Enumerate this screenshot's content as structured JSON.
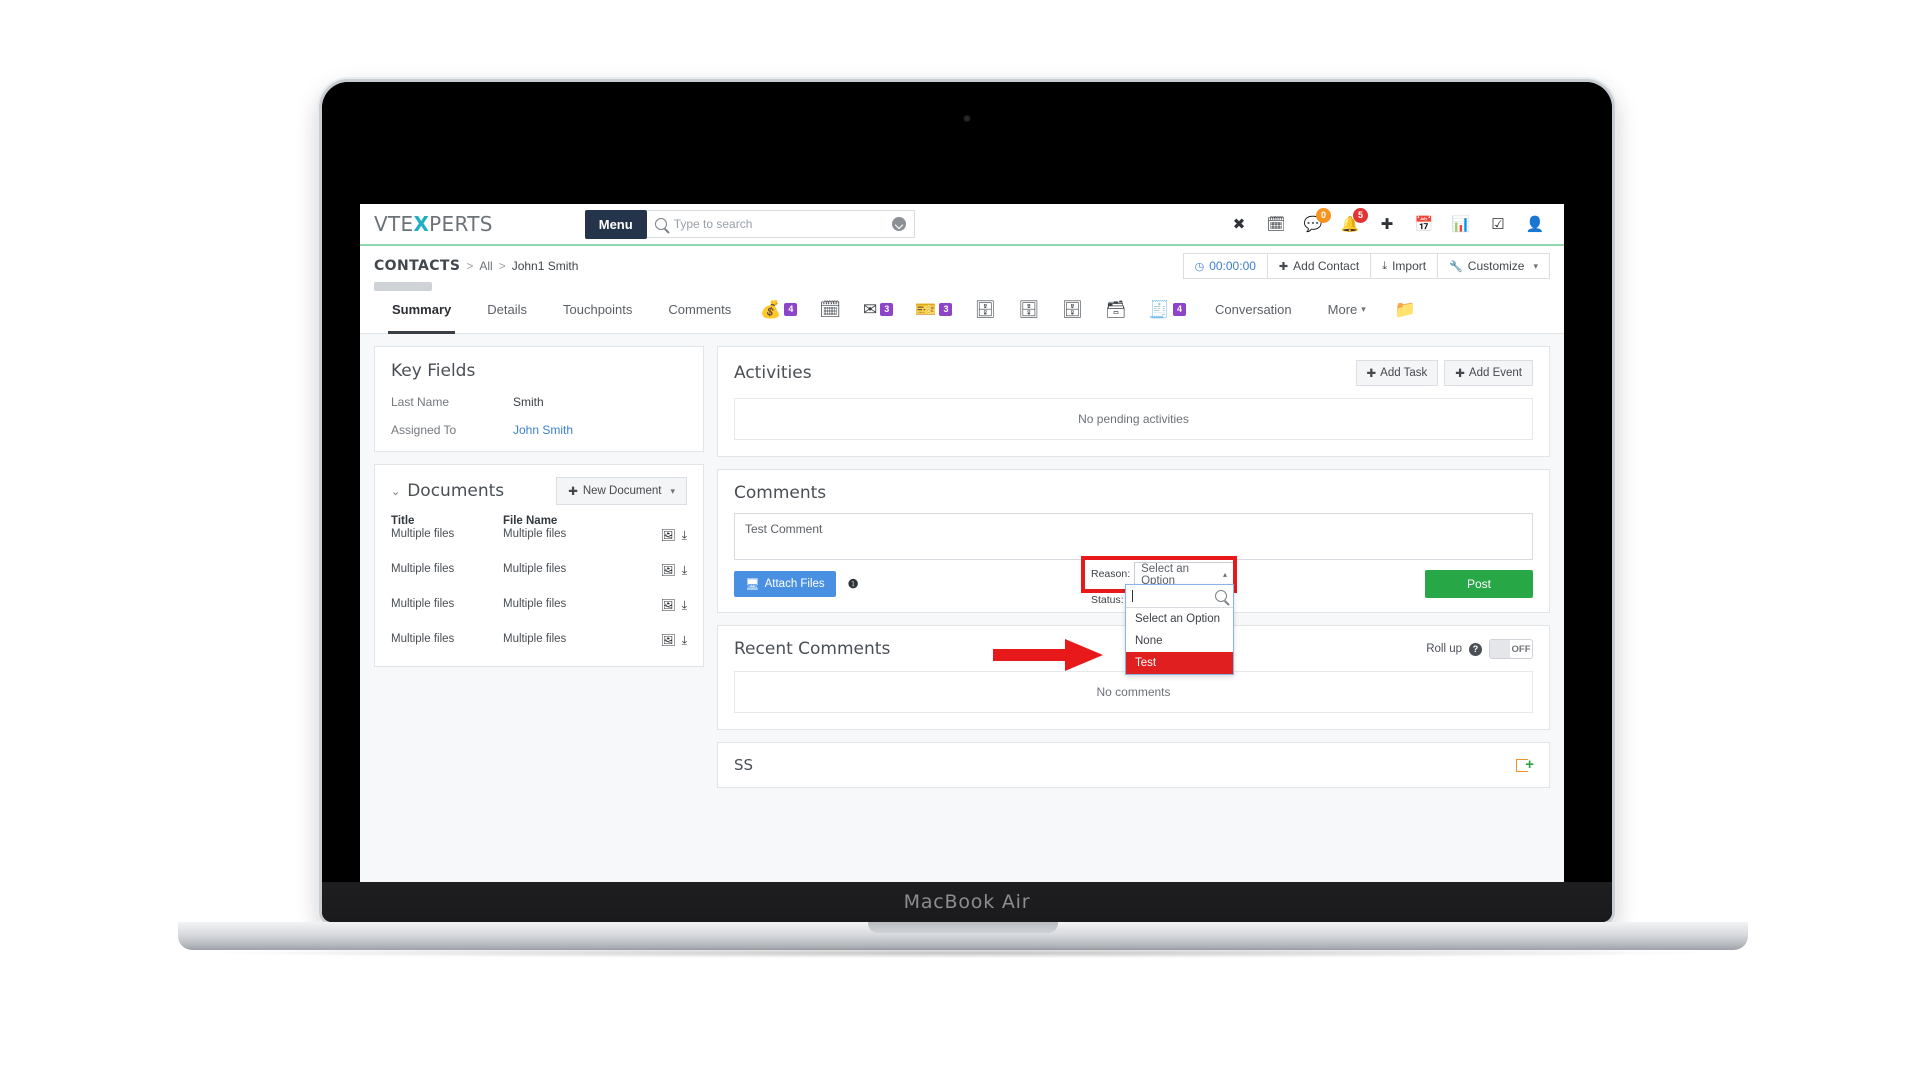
{
  "device": {
    "label": "MacBook Air"
  },
  "topnav": {
    "logo_pre": "VTE",
    "logo_x": "X",
    "logo_post": "PERTS",
    "menu_label": "Menu",
    "search_placeholder": "Type to search",
    "icons": [
      {
        "name": "x-app-icon",
        "glyph": "✖",
        "badge": ""
      },
      {
        "name": "calendar-check-icon",
        "glyph": "🗓",
        "badge": ""
      },
      {
        "name": "chat-icon",
        "glyph": "💬",
        "badge": "0",
        "badge_color": "orange"
      },
      {
        "name": "bell-icon",
        "glyph": "🔔",
        "badge": "5",
        "badge_color": "red"
      },
      {
        "name": "plus-circle-icon",
        "glyph": "✚",
        "badge": ""
      },
      {
        "name": "calendar-icon",
        "glyph": "📅",
        "badge": ""
      },
      {
        "name": "chart-icon",
        "glyph": "📊",
        "badge": ""
      },
      {
        "name": "checkbox-icon",
        "glyph": "☑",
        "badge": ""
      },
      {
        "name": "user-icon",
        "glyph": "👤",
        "badge": ""
      }
    ]
  },
  "breadcrumb": {
    "module": "CONTACTS",
    "sep": ">",
    "list": "All",
    "record": "John1 Smith",
    "buttons": [
      {
        "name": "timer-button",
        "icon": "◷",
        "label": "00:00:00",
        "accent": true
      },
      {
        "name": "add-contact-button",
        "icon": "✚",
        "label": "Add Contact"
      },
      {
        "name": "import-button",
        "icon": "⤓",
        "label": "Import"
      },
      {
        "name": "customize-button",
        "icon": "🔧",
        "label": "Customize",
        "caret": "▾"
      }
    ]
  },
  "tabs": {
    "text_tabs": [
      {
        "label": "Summary",
        "active": true
      },
      {
        "label": "Details",
        "active": false
      },
      {
        "label": "Touchpoints",
        "active": false
      },
      {
        "label": "Comments",
        "active": false
      }
    ],
    "icon_tabs": [
      {
        "name": "tab-opportunities",
        "glyph": "💰",
        "badge": "4"
      },
      {
        "name": "tab-calendar",
        "glyph": "🗓",
        "badge": ""
      },
      {
        "name": "tab-emails",
        "glyph": "✉",
        "badge": "3"
      },
      {
        "name": "tab-tickets",
        "glyph": "🎫",
        "badge": "3"
      },
      {
        "name": "tab-quotes",
        "glyph": "🗄",
        "badge": ""
      },
      {
        "name": "tab-purchase-orders",
        "glyph": "🗄",
        "badge": ""
      },
      {
        "name": "tab-sales-orders",
        "glyph": "🗄",
        "badge": ""
      },
      {
        "name": "tab-products",
        "glyph": "🗃",
        "badge": ""
      },
      {
        "name": "tab-invoices",
        "glyph": "🧾",
        "badge": "4"
      }
    ],
    "conversation_label": "Conversation",
    "more_label": "More",
    "more_caret": "▾",
    "folder_icon": "📁"
  },
  "key_fields": {
    "title": "Key Fields",
    "rows": [
      {
        "label": "Last Name",
        "value": "Smith",
        "is_link": false
      },
      {
        "label": "Assigned To",
        "value": "John Smith",
        "is_link": true
      }
    ]
  },
  "documents": {
    "chevron": "⌄",
    "title": "Documents",
    "new_button_icon": "✚",
    "new_button_label": "New Document",
    "new_button_caret": "▾",
    "columns": {
      "title": "Title",
      "file_name": "File Name"
    },
    "rows": [
      {
        "title": "Multiple files",
        "file_name": "Multiple files"
      },
      {
        "title": "Multiple files",
        "file_name": "Multiple files"
      },
      {
        "title": "Multiple files",
        "file_name": "Multiple files"
      },
      {
        "title": "Multiple files",
        "file_name": "Multiple files"
      }
    ],
    "row_icons": {
      "preview": "🖼",
      "download": "⤓"
    }
  },
  "activities": {
    "title": "Activities",
    "add_task_icon": "✚",
    "add_task_label": "Add Task",
    "add_event_icon": "✚",
    "add_event_label": "Add Event",
    "empty_text": "No pending activities"
  },
  "comments": {
    "title": "Comments",
    "textarea_value": "Test Comment",
    "attach_icon": "🖥",
    "attach_label": "Attach Files",
    "info_icon": "❶",
    "post_label": "Post",
    "reason_label": "Reason:",
    "reason_value": "Select an Option",
    "reason_caret": "▴",
    "status_label": "Status:",
    "status_value": "",
    "dropdown": {
      "search_value": "",
      "search_icon": "search-icon",
      "options": [
        {
          "label": "Select an Option",
          "selected": false
        },
        {
          "label": "None",
          "selected": false
        },
        {
          "label": "Test",
          "selected": true
        }
      ]
    }
  },
  "recent_comments": {
    "title": "Recent Comments",
    "rollup_label": "Roll up",
    "help_icon": "?",
    "toggle_state": "OFF",
    "empty_text": "No comments"
  },
  "ss_panel": {
    "title": "SS",
    "add_icon": "add-folder-icon"
  },
  "colors": {
    "accent_green": "#8fd8b0",
    "post_green": "#27a745",
    "attach_blue": "#4a90e2",
    "badge_purple": "#8e44c8",
    "badge_red": "#e13434",
    "badge_orange": "#f79320",
    "highlight_red": "#e02020",
    "annotation_red": "#e8191b",
    "link_blue": "#3d7fd1",
    "menu_navy": "#24344a",
    "logo_teal": "#1eafc4"
  }
}
